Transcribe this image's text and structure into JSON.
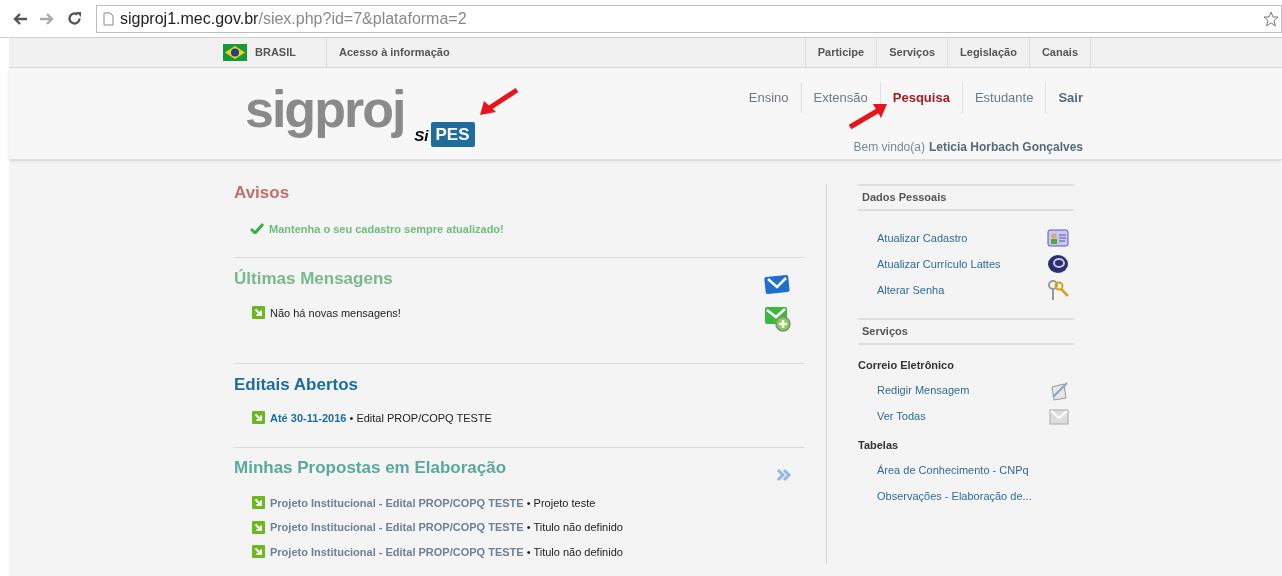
{
  "browser": {
    "url_host": "sigproj1.mec.gov.br",
    "url_path": "/siex.php?id=7&plataforma=2"
  },
  "gov_bar": {
    "country": "BRASIL",
    "access": "Acesso à informação",
    "links": [
      "Participe",
      "Serviços",
      "Legislação",
      "Canais"
    ]
  },
  "header": {
    "logo": "sigproj",
    "badge_prefix": "Si",
    "badge": "PES",
    "nav": [
      {
        "label": "Ensino",
        "selected": false
      },
      {
        "label": "Extensão",
        "selected": false
      },
      {
        "label": "Pesquisa",
        "selected": true
      },
      {
        "label": "Estudante",
        "selected": false
      }
    ],
    "logout": "Sair",
    "welcome": "Bem vindo(a)",
    "user": "Leticia Horbach Gonçalves"
  },
  "avisos": {
    "title": "Avisos",
    "items": [
      "Mantenha o seu cadastro sempre atualizado!"
    ]
  },
  "mensagens": {
    "title": "Últimas Mensagens",
    "items": [
      "Não há novas mensagens!"
    ]
  },
  "editais": {
    "title": "Editais Abertos",
    "items": [
      {
        "date": "Até 30-11-2016",
        "text": "• Edital PROP/COPQ TESTE"
      }
    ]
  },
  "propostas": {
    "title": "Minhas Propostas em Elaboração",
    "items": [
      {
        "link": "Projeto Institucional - Edital PROP/COPQ TESTE",
        "text": "• Projeto teste"
      },
      {
        "link": "Projeto Institucional - Edital PROP/COPQ TESTE",
        "text": "• Titulo não definido"
      },
      {
        "link": "Projeto Institucional - Edital PROP/COPQ TESTE",
        "text": "• Titulo não definido"
      }
    ]
  },
  "sidebar": [
    {
      "title": "Dados Pessoais",
      "groups": [
        {
          "items": [
            {
              "label": "Atualizar Cadastro",
              "kind": "card"
            },
            {
              "label": "Atualizar Currículo Lattes",
              "kind": "lattes"
            },
            {
              "label": "Alterar Senha",
              "kind": "keys"
            }
          ]
        }
      ]
    },
    {
      "title": "Serviços",
      "groups": [
        {
          "heading": "Correio Eletrônico",
          "items": [
            {
              "label": "Redigir Mensagem",
              "kind": "compose"
            },
            {
              "label": "Ver Todas",
              "kind": "mail"
            }
          ]
        },
        {
          "heading": "Tabelas",
          "items": [
            {
              "label": "Área de Conhecimento - CNPq",
              "kind": "none"
            },
            {
              "label": "Observações - Elaboração de...",
              "kind": "none"
            }
          ]
        }
      ]
    }
  ]
}
